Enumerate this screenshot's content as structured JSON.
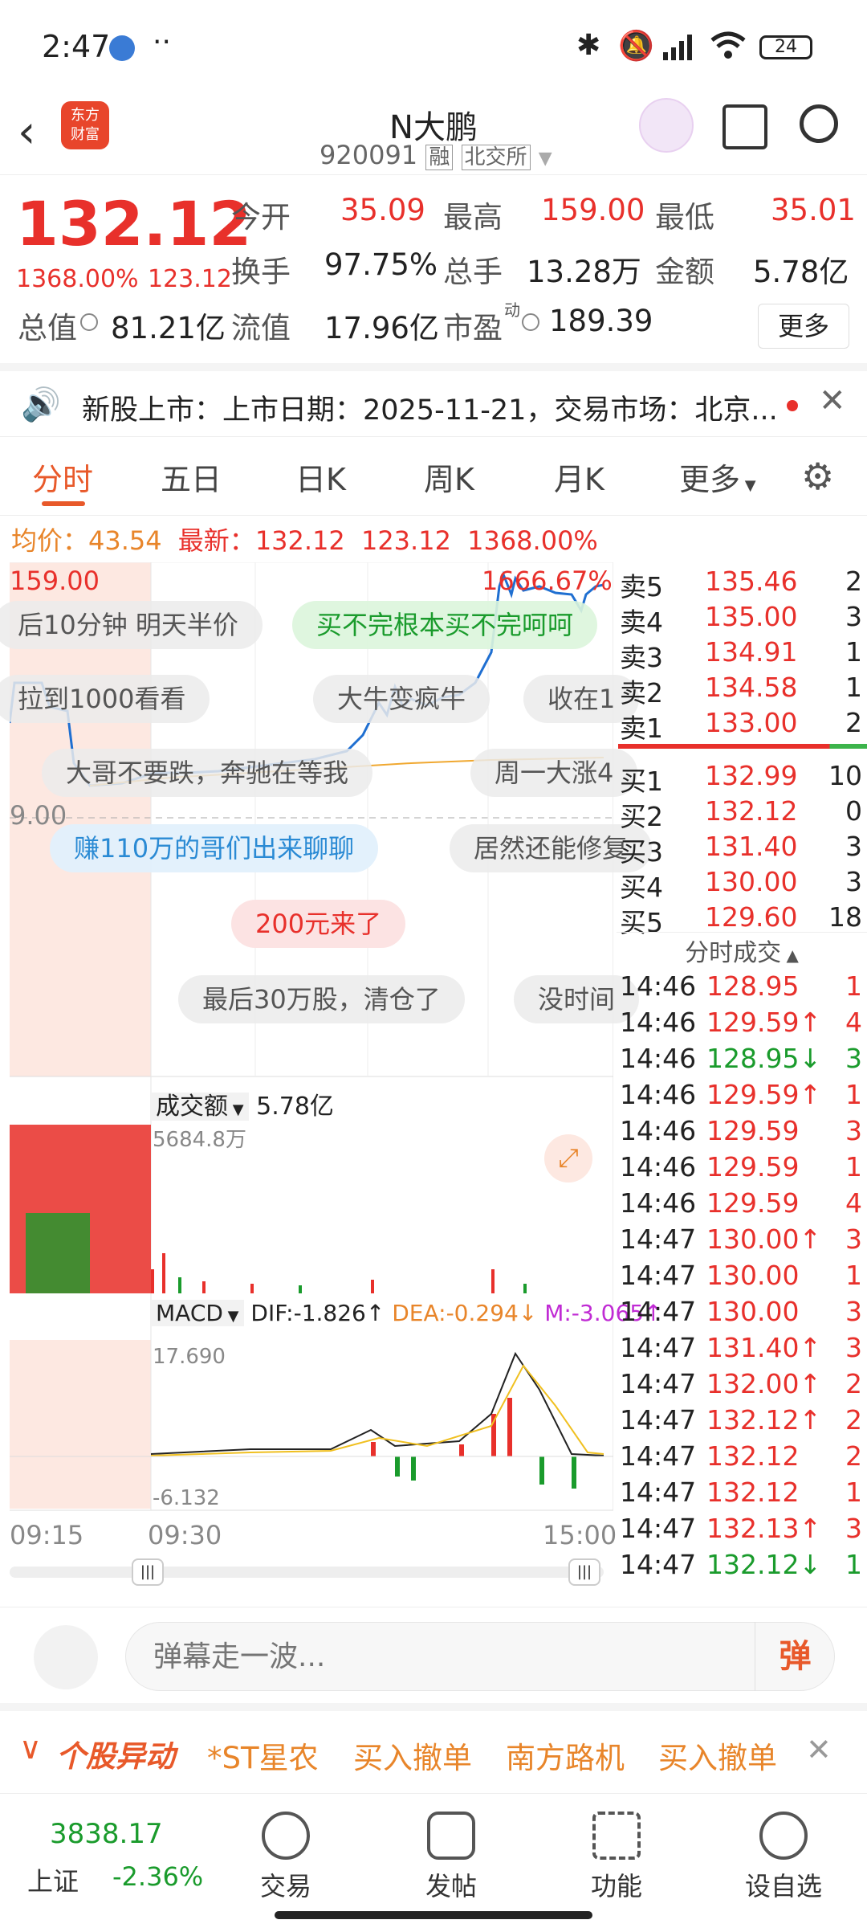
{
  "status": {
    "time": "2:47",
    "dots": "··",
    "battery": "24"
  },
  "header": {
    "title": "N大鹏",
    "code": "920091",
    "tag_margin": "融",
    "tag_market": "北交所"
  },
  "quote": {
    "price": "132.12",
    "pct": "1368.00%",
    "chg": "123.12",
    "open_label": "今开",
    "open": "35.09",
    "high_label": "最高",
    "high": "159.00",
    "low_label": "最低",
    "low": "35.01",
    "turnover_label": "换手",
    "turnover": "97.75%",
    "vol_label": "总手",
    "vol": "13.28万",
    "amt_label": "金额",
    "amt": "5.78亿",
    "mcap_label": "总值",
    "mcap": "81.21亿",
    "float_label": "流值",
    "float": "17.96亿",
    "pe_label": "市盈",
    "pe_sup": "动",
    "pe": "189.39",
    "more": "更多"
  },
  "news": {
    "text": "新股上市：上市日期：2025-11-21，交易市场：北京..."
  },
  "tabs": [
    "分时",
    "五日",
    "日K",
    "周K",
    "月K",
    "更多"
  ],
  "avgline": {
    "avg_label": "均价：",
    "avg": "43.54",
    "latest_label": "最新：",
    "latest": "132.12",
    "chg": "123.12",
    "pct": "1368.00%"
  },
  "chart": {
    "top_price": "159.00",
    "top_pct": "1666.67%",
    "base_price": "9.00",
    "vol_label": "成交额",
    "vol_total": "5.78亿",
    "vol_max": "5684.8万",
    "macd_label": "MACD",
    "dif": "DIF:-1.826↑",
    "dea": "DEA:-0.294↓",
    "m": "M:-3.065↑",
    "macd_max": "17.690",
    "macd_min": "-6.132",
    "t1": "09:15",
    "t2": "09:30",
    "t3": "15:00"
  },
  "danmu": [
    "后10分钟 明天半价",
    "买不完根本买不完呵呵",
    "拉到1000看看",
    "大牛变疯牛",
    "收在1",
    "大哥不要跌，奔驰在等我",
    "周一大涨4",
    "赚110万的哥们出来聊聊",
    "居然还能修复",
    "200元来了",
    "最后30万股，清仓了",
    "没时间"
  ],
  "book": {
    "asks": [
      {
        "l": "卖5",
        "p": "135.46",
        "v": "2"
      },
      {
        "l": "卖4",
        "p": "135.00",
        "v": "3"
      },
      {
        "l": "卖3",
        "p": "134.91",
        "v": "1"
      },
      {
        "l": "卖2",
        "p": "134.58",
        "v": "1"
      },
      {
        "l": "卖1",
        "p": "133.00",
        "v": "2"
      }
    ],
    "bids": [
      {
        "l": "买1",
        "p": "132.99",
        "v": "10"
      },
      {
        "l": "买2",
        "p": "132.12",
        "v": "0"
      },
      {
        "l": "买3",
        "p": "131.40",
        "v": "3"
      },
      {
        "l": "买4",
        "p": "130.00",
        "v": "3"
      },
      {
        "l": "买5",
        "p": "129.60",
        "v": "18"
      }
    ],
    "trades_title": "分时成交",
    "trades": [
      {
        "t": "14:46",
        "p": "128.95",
        "v": "1",
        "c": "red"
      },
      {
        "t": "14:46",
        "p": "129.59↑",
        "v": "4",
        "c": "red"
      },
      {
        "t": "14:46",
        "p": "128.95↓",
        "v": "3",
        "c": "green"
      },
      {
        "t": "14:46",
        "p": "129.59↑",
        "v": "1",
        "c": "red"
      },
      {
        "t": "14:46",
        "p": "129.59",
        "v": "3",
        "c": "red"
      },
      {
        "t": "14:46",
        "p": "129.59",
        "v": "1",
        "c": "red"
      },
      {
        "t": "14:46",
        "p": "129.59",
        "v": "4",
        "c": "red"
      },
      {
        "t": "14:47",
        "p": "130.00↑",
        "v": "3",
        "c": "red"
      },
      {
        "t": "14:47",
        "p": "130.00",
        "v": "1",
        "c": "red"
      },
      {
        "t": "14:47",
        "p": "130.00",
        "v": "3",
        "c": "red"
      },
      {
        "t": "14:47",
        "p": "131.40↑",
        "v": "3",
        "c": "red"
      },
      {
        "t": "14:47",
        "p": "132.00↑",
        "v": "2",
        "c": "red"
      },
      {
        "t": "14:47",
        "p": "132.12↑",
        "v": "2",
        "c": "red"
      },
      {
        "t": "14:47",
        "p": "132.12",
        "v": "2",
        "c": "red"
      },
      {
        "t": "14:47",
        "p": "132.12",
        "v": "1",
        "c": "red"
      },
      {
        "t": "14:47",
        "p": "132.13↑",
        "v": "3",
        "c": "red"
      },
      {
        "t": "14:47",
        "p": "132.12↓",
        "v": "1",
        "c": "green"
      }
    ]
  },
  "input": {
    "placeholder": "弹幕走一波...",
    "send": "弹"
  },
  "ticker": {
    "label": "个股异动",
    "items": [
      "*ST星农",
      "买入撤单",
      "南方路机",
      "买入撤单"
    ]
  },
  "nav": {
    "index_value": "3838.17",
    "index_name": "上证",
    "index_pct": "-2.36%",
    "items": [
      "交易",
      "发帖",
      "功能",
      "设自选"
    ]
  }
}
